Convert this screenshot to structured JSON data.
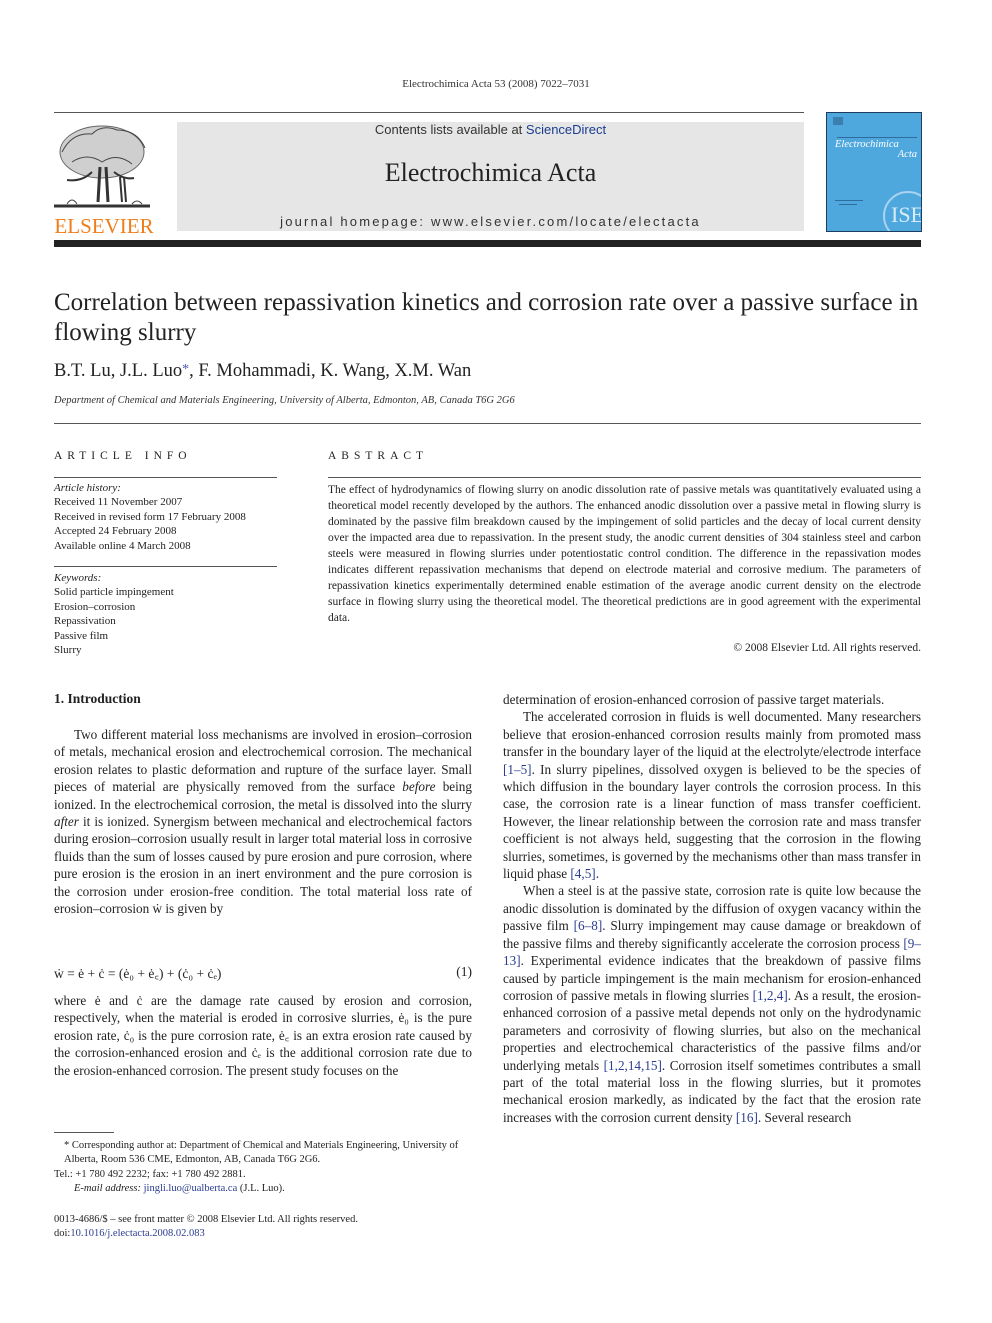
{
  "running_head": "Electrochimica Acta 53 (2008) 7022–7031",
  "header": {
    "publisher_logo_text": "ELSEVIER",
    "contents_prefix": "Contents lists available at ",
    "contents_link": "ScienceDirect",
    "journal_title": "Electrochimica Acta",
    "homepage": "journal homepage: www.elsevier.com/locate/electacta",
    "cover": {
      "title_line1": "Electrochimica",
      "title_line2": "Acta",
      "seal_text": "ISE",
      "background_color": "#4ea8de"
    }
  },
  "article": {
    "title": "Correlation between repassivation kinetics and corrosion rate over a passive surface in flowing slurry",
    "authors_before_star": "B.T. Lu, J.L. Luo",
    "author_star": "*",
    "authors_after_star": ", F. Mohammadi, K. Wang, X.M. Wan",
    "affiliation": "Department of Chemical and Materials Engineering, University of Alberta, Edmonton, AB, Canada T6G 2G6"
  },
  "article_info": {
    "heading": "ARTICLE INFO",
    "history_label": "Article history:",
    "history": [
      "Received 11 November 2007",
      "Received in revised form 17 February 2008",
      "Accepted 24 February 2008",
      "Available online 4 March 2008"
    ],
    "keywords_label": "Keywords:",
    "keywords": [
      "Solid particle impingement",
      "Erosion–corrosion",
      "Repassivation",
      "Passive film",
      "Slurry"
    ]
  },
  "abstract": {
    "heading": "ABSTRACT",
    "text": "The effect of hydrodynamics of flowing slurry on anodic dissolution rate of passive metals was quantitatively evaluated using a theoretical model recently developed by the authors. The enhanced anodic dissolution over a passive metal in flowing slurry is dominated by the passive film breakdown caused by the impingement of solid particles and the decay of local current density over the impacted area due to repassivation. In the present study, the anodic current densities of 304 stainless steel and carbon steels were measured in flowing slurries under potentiostatic control condition. The difference in the repassivation modes indicates different repassivation mechanisms that depend on electrode material and corrosive medium. The parameters of repassivation kinetics experimentally determined enable estimation of the average anodic current density on the electrode surface in flowing slurry using the theoretical model. The theoretical predictions are in good agreement with the experimental data.",
    "copyright": "© 2008 Elsevier Ltd. All rights reserved."
  },
  "body": {
    "section_heading": "1.  Introduction",
    "left_p1_a": "Two different material loss mechanisms are involved in erosion–corrosion of metals, mechanical erosion and electrochemical corrosion. The mechanical erosion relates to plastic deformation and rupture of the surface layer. Small pieces of material are physically removed from the surface ",
    "left_p1_em1": "before",
    "left_p1_b": " being ionized. In the electrochemical corrosion, the metal is dissolved into the slurry ",
    "left_p1_em2": "after",
    "left_p1_c": " it is ionized. Synergism between mechanical and electrochemical factors during erosion–corrosion usually result in larger total material loss in corrosive fluids than the sum of losses caused by pure erosion and pure corrosion, where pure erosion is the erosion in an inert environment and the pure corrosion is the corrosion under erosion-free condition. The total material loss rate of erosion–corrosion ẇ is given by",
    "equation": "ẇ = ė + ċ = (ė₀ + ė꜀) + (ċ₀ + ċₑ)",
    "equation_number": "(1)",
    "left_p2": "where ė and ċ are the damage rate caused by erosion and corrosion, respectively, when the material is eroded in corrosive slurries, ė₀ is the pure erosion rate, ċ₀ is the pure corrosion rate, ė꜀ is an extra erosion rate caused by the corrosion-enhanced erosion and ċₑ is the additional corrosion rate due to the erosion-enhanced corrosion. The present study focuses on the",
    "right_p0": "determination of erosion-enhanced corrosion of passive target materials.",
    "right_p1_a": "The accelerated corrosion in fluids is well documented. Many researchers believe that erosion-enhanced corrosion results mainly from promoted mass transfer in the boundary layer of the liquid at the electrolyte/electrode interface ",
    "right_p1_ref1": "[1–5]",
    "right_p1_b": ". In slurry pipelines, dissolved oxygen is believed to be the species of which diffusion in the boundary layer controls the corrosion process. In this case, the corrosion rate is a linear function of mass transfer coefficient. However, the linear relationship between the corrosion rate and mass transfer coefficient is not always held, suggesting that the corrosion in the flowing slurries, sometimes, is governed by the mechanisms other than mass transfer in liquid phase ",
    "right_p1_ref2": "[4,5]",
    "right_p1_c": ".",
    "right_p2_a": "When a steel is at the passive state, corrosion rate is quite low because the anodic dissolution is dominated by the diffusion of oxygen vacancy within the passive film ",
    "right_p2_ref1": "[6–8]",
    "right_p2_b": ". Slurry impingement may cause damage or breakdown of the passive films and thereby significantly accelerate the corrosion process ",
    "right_p2_ref2": "[9–13]",
    "right_p2_c": ". Experimental evidence indicates that the breakdown of passive films caused by particle impingement is the main mechanism for erosion-enhanced corrosion of passive metals in flowing slurries ",
    "right_p2_ref3": "[1,2,4]",
    "right_p2_d": ". As a result, the erosion-enhanced corrosion of a passive metal depends not only on the hydrodynamic parameters and corrosivity of flowing slurries, but also on the mechanical properties and electrochemical characteristics of the passive films and/or underlying metals ",
    "right_p2_ref4": "[1,2,14,15]",
    "right_p2_e": ". Corrosion itself sometimes contributes a small part of the total material loss in the flowing slurries, but it promotes mechanical erosion markedly, as indicated by the fact that the erosion rate increases with the corrosion current density ",
    "right_p2_ref5": "[16]",
    "right_p2_f": ". Several research"
  },
  "footnote": {
    "corresponding": "* Corresponding author at: Department of Chemical and Materials Engineering, University of Alberta, Room 536 CME, Edmonton, AB, Canada T6G 2G6.",
    "tel": "Tel.: +1 780 492 2232; fax: +1 780 492 2881.",
    "email_label": "E-mail address:",
    "email": "jingli.luo@ualberta.ca",
    "email_suffix": " (J.L. Luo)."
  },
  "issn": {
    "line1": "0013-4686/$ – see front matter © 2008 Elsevier Ltd. All rights reserved.",
    "doi_prefix": "doi:",
    "doi": "10.1016/j.electacta.2008.02.083"
  }
}
